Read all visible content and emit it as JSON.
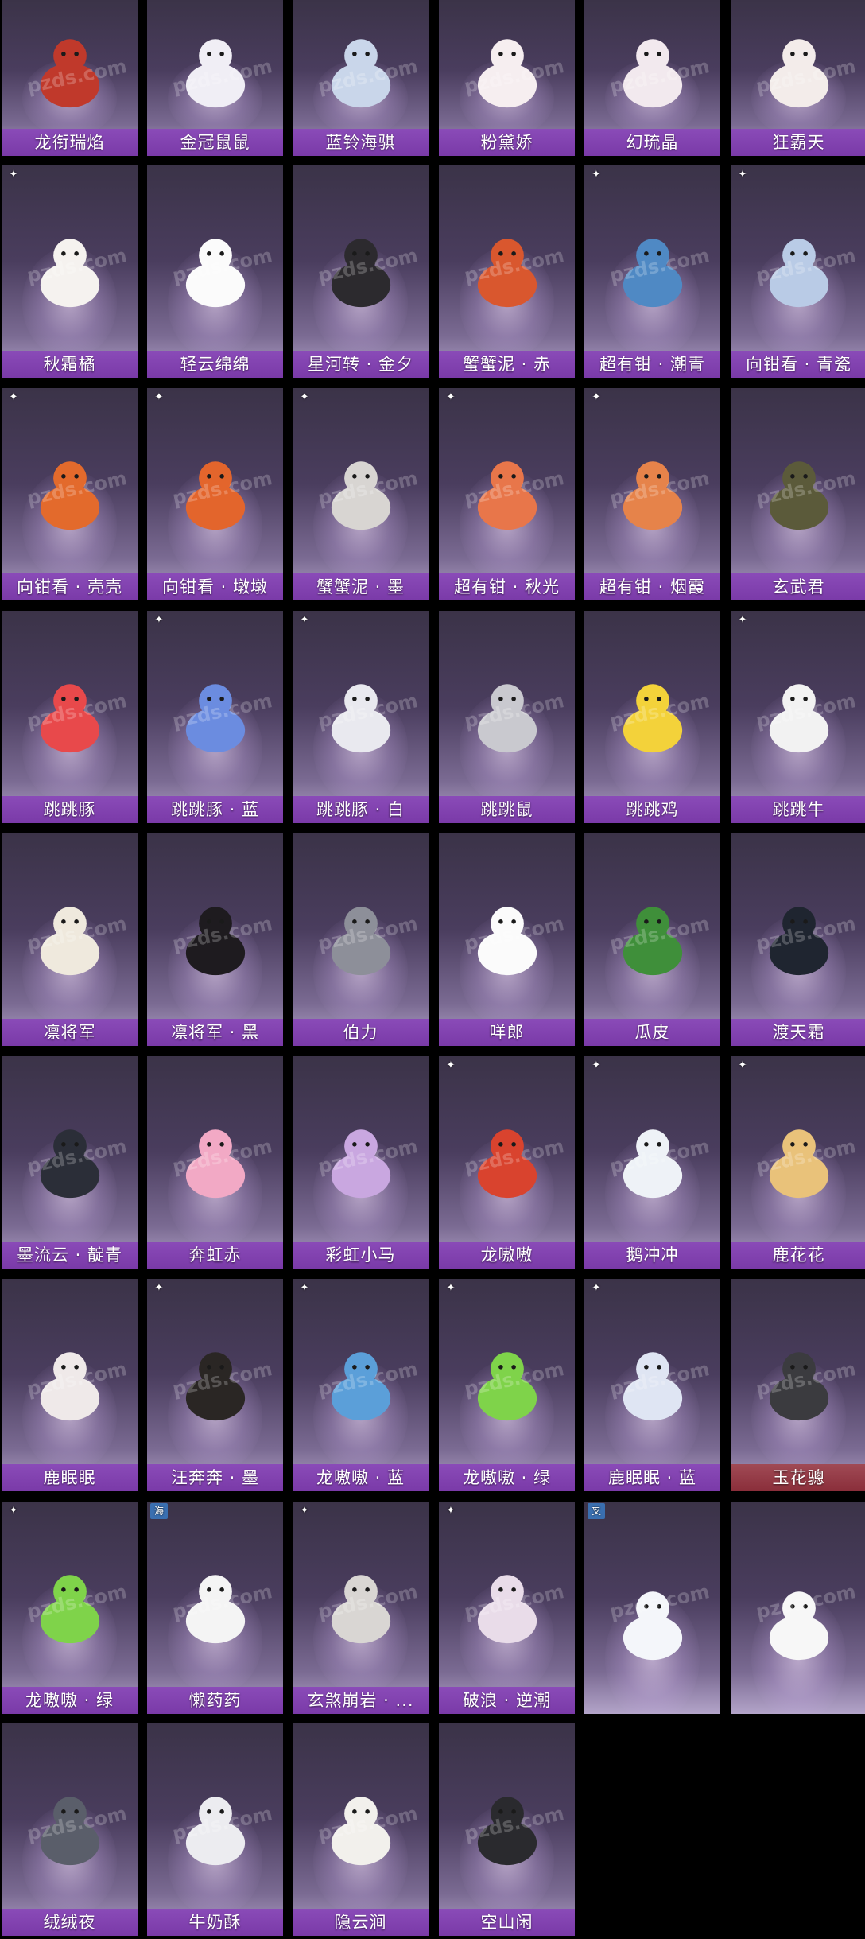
{
  "watermark_text": "pzds.com",
  "cards": [
    {
      "name": "龙衔瑞焰",
      "badge": "",
      "tint": "#c0392b"
    },
    {
      "name": "金冠鼠鼠",
      "badge": "",
      "tint": "#f0eef5"
    },
    {
      "name": "蓝铃海骐",
      "badge": "",
      "tint": "#c9d6ea"
    },
    {
      "name": "粉黛娇",
      "badge": "",
      "tint": "#f6eef0"
    },
    {
      "name": "幻琉晶",
      "badge": "",
      "tint": "#f2e9ee"
    },
    {
      "name": "狂霸天",
      "badge": "",
      "tint": "#f3ecea"
    },
    {
      "name": "秋霜橘",
      "badge": "✦",
      "tint": "#f5f2ef"
    },
    {
      "name": "轻云绵绵",
      "badge": "",
      "tint": "#fbfbfb"
    },
    {
      "name": "星河转 · 金夕",
      "badge": "",
      "tint": "#2c2a2e"
    },
    {
      "name": "蟹蟹泥 · 赤",
      "badge": "",
      "tint": "#d9572e"
    },
    {
      "name": "超有钳 · 潮青",
      "badge": "✦",
      "tint": "#4f89c4"
    },
    {
      "name": "向钳看 · 青瓷",
      "badge": "✦",
      "tint": "#b9cbe6"
    },
    {
      "name": "向钳看 · 壳壳",
      "badge": "✦",
      "tint": "#e36a2c"
    },
    {
      "name": "向钳看 · 墩墩",
      "badge": "✦",
      "tint": "#e3652c"
    },
    {
      "name": "蟹蟹泥 · 墨",
      "badge": "✦",
      "tint": "#d8d5d2"
    },
    {
      "name": "超有钳 · 秋光",
      "badge": "✦",
      "tint": "#e8764a"
    },
    {
      "name": "超有钳 · 烟霞",
      "badge": "✦",
      "tint": "#e6834a"
    },
    {
      "name": "玄武君",
      "badge": "",
      "tint": "#5b5a3a"
    },
    {
      "name": "跳跳豚",
      "badge": "",
      "tint": "#e8494b"
    },
    {
      "name": "跳跳豚 · 蓝",
      "badge": "✦",
      "tint": "#6b8ce0"
    },
    {
      "name": "跳跳豚 · 白",
      "badge": "✦",
      "tint": "#e9e9ef"
    },
    {
      "name": "跳跳鼠",
      "badge": "",
      "tint": "#c9c9cf"
    },
    {
      "name": "跳跳鸡",
      "badge": "",
      "tint": "#f3d23a"
    },
    {
      "name": "跳跳牛",
      "badge": "✦",
      "tint": "#f2f2f2"
    },
    {
      "name": "凛将军",
      "badge": "",
      "tint": "#efe9dd"
    },
    {
      "name": "凛将军 · 黑",
      "badge": "",
      "tint": "#1e1b1f"
    },
    {
      "name": "伯力",
      "badge": "",
      "tint": "#8d8f99"
    },
    {
      "name": "咩郎",
      "badge": "",
      "tint": "#fbfbfb"
    },
    {
      "name": "瓜皮",
      "badge": "",
      "tint": "#3f8f3a"
    },
    {
      "name": "渡天霜",
      "badge": "",
      "tint": "#1f2530"
    },
    {
      "name": "墨流云 · 靛青",
      "badge": "",
      "tint": "#2b2e38"
    },
    {
      "name": "奔虹赤",
      "badge": "",
      "tint": "#f2a9c5"
    },
    {
      "name": "彩虹小马",
      "badge": "",
      "tint": "#c9a7e0"
    },
    {
      "name": "龙嗷嗷",
      "badge": "✦",
      "tint": "#d9432e"
    },
    {
      "name": "鹅冲冲",
      "badge": "✦",
      "tint": "#eef2f7"
    },
    {
      "name": "鹿花花",
      "badge": "✦",
      "tint": "#e9c27a"
    },
    {
      "name": "鹿眠眠",
      "badge": "",
      "tint": "#efe9e9"
    },
    {
      "name": "汪奔奔 · 墨",
      "badge": "✦",
      "tint": "#2a2624"
    },
    {
      "name": "龙嗷嗷 · 蓝",
      "badge": "✦",
      "tint": "#5b9fd9"
    },
    {
      "name": "龙嗷嗷 · 绿",
      "badge": "✦",
      "tint": "#7fd34a"
    },
    {
      "name": "鹿眠眠 · 蓝",
      "badge": "✦",
      "tint": "#dfe5f3"
    },
    {
      "name": "玉花骢",
      "badge": "",
      "tint": "#3b3b3f",
      "red": true
    },
    {
      "name": "龙嗷嗷 · 绿",
      "badge": "✦",
      "tint": "#7fd34a"
    },
    {
      "name": "懒药药",
      "badge": "海",
      "tint": "#f4f4f4"
    },
    {
      "name": "玄煞崩岩 · ...",
      "badge": "✦",
      "tint": "#d9d6d3"
    },
    {
      "name": "破浪 · 逆潮",
      "badge": "✦",
      "tint": "#e9dce9"
    },
    {
      "name": "",
      "badge": "叉",
      "tint": "#f4f6fa",
      "no_label": true
    },
    {
      "name": "",
      "badge": "",
      "tint": "#f7f7f7",
      "no_label": true
    },
    {
      "name": "绒绒夜",
      "badge": "",
      "tint": "#5a5e6a"
    },
    {
      "name": "牛奶酥",
      "badge": "",
      "tint": "#ececf0"
    },
    {
      "name": "隐云涧",
      "badge": "",
      "tint": "#f2f0ec"
    },
    {
      "name": "空山闲",
      "badge": "",
      "tint": "#2a2a2e"
    }
  ]
}
